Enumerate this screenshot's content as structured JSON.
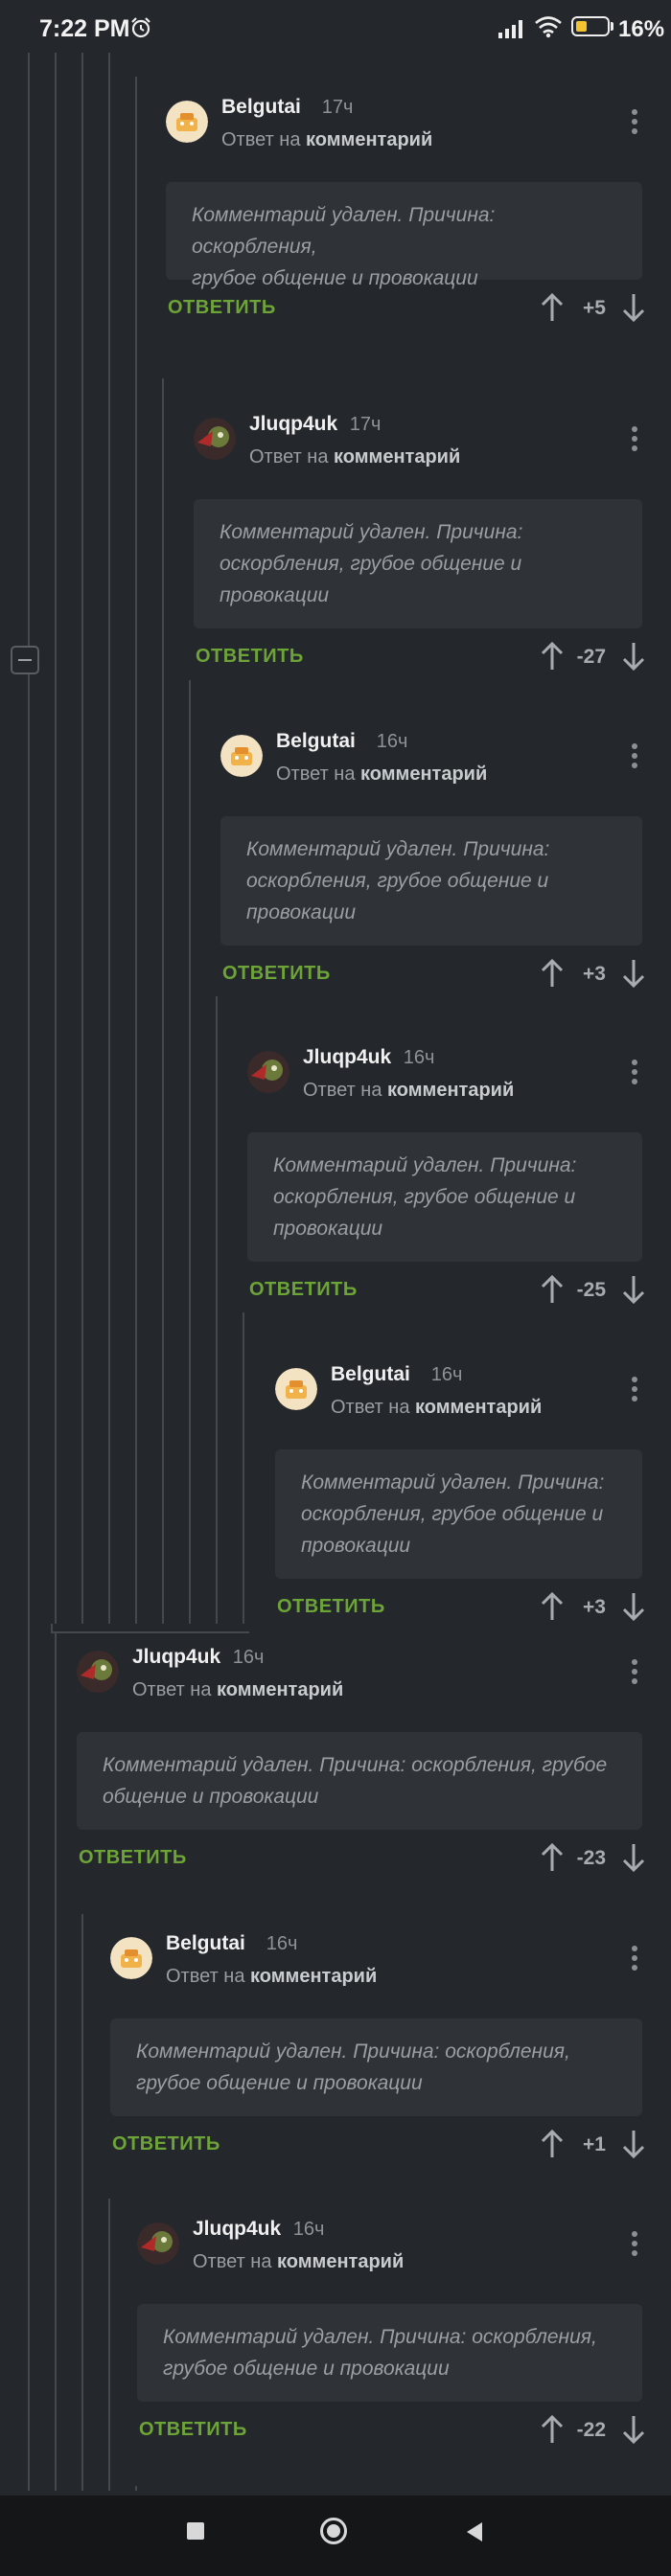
{
  "status_bar": {
    "time": "7:22 PM",
    "battery_percent": "16%",
    "battery_level": 0.16
  },
  "thread": {
    "reply_prefix": "Ответ на",
    "reply_target": "комментарий",
    "reply_label": "ОТВЕТИТЬ",
    "comments": [
      {
        "author": "Belgutai",
        "time": "17ч",
        "avatar": "belgutai-avatar",
        "body_lines": [
          "Комментарий удален. Причина: оскорбления,",
          "грубое общение и провокации"
        ],
        "score": "+5"
      },
      {
        "author": "Jluqp4uk",
        "time": "17ч",
        "avatar": "jluqp4uk-avatar",
        "body_lines": [
          "Комментарий удален. Причина:",
          "оскорбления, грубое общение и",
          "провокации"
        ],
        "score": "-27"
      },
      {
        "author": "Belgutai",
        "time": "16ч",
        "avatar": "belgutai-avatar",
        "body_lines": [
          "Комментарий удален. Причина:",
          "оскорбления, грубое общение и",
          "провокации"
        ],
        "score": "+3"
      },
      {
        "author": "Jluqp4uk",
        "time": "16ч",
        "avatar": "jluqp4uk-avatar",
        "body_lines": [
          "Комментарий удален. Причина:",
          "оскорбления, грубое общение и",
          "провокации"
        ],
        "score": "-25"
      },
      {
        "author": "Belgutai",
        "time": "16ч",
        "avatar": "belgutai-avatar",
        "body_lines": [
          "Комментарий удален. Причина:",
          "оскорбления, грубое общение и",
          "провокации"
        ],
        "score": "+3"
      },
      {
        "author": "Jluqp4uk",
        "time": "16ч",
        "avatar": "jluqp4uk-avatar",
        "body_lines": [
          "Комментарий удален. Причина: оскорбления, грубое",
          "общение и провокации"
        ],
        "score": "-23"
      },
      {
        "author": "Belgutai",
        "time": "16ч",
        "avatar": "belgutai-avatar",
        "body_lines": [
          "Комментарий удален. Причина: оскорбления,",
          "грубое общение и провокации"
        ],
        "score": "+1"
      },
      {
        "author": "Jluqp4uk",
        "time": "16ч",
        "avatar": "jluqp4uk-avatar",
        "body_lines": [
          "Комментарий удален. Причина: оскорбления,",
          "грубое общение и провокации"
        ],
        "score": "-22"
      }
    ]
  },
  "colors": {
    "background": "#24272b",
    "accent_reply": "#6da437",
    "body_box": "#2f3236"
  }
}
